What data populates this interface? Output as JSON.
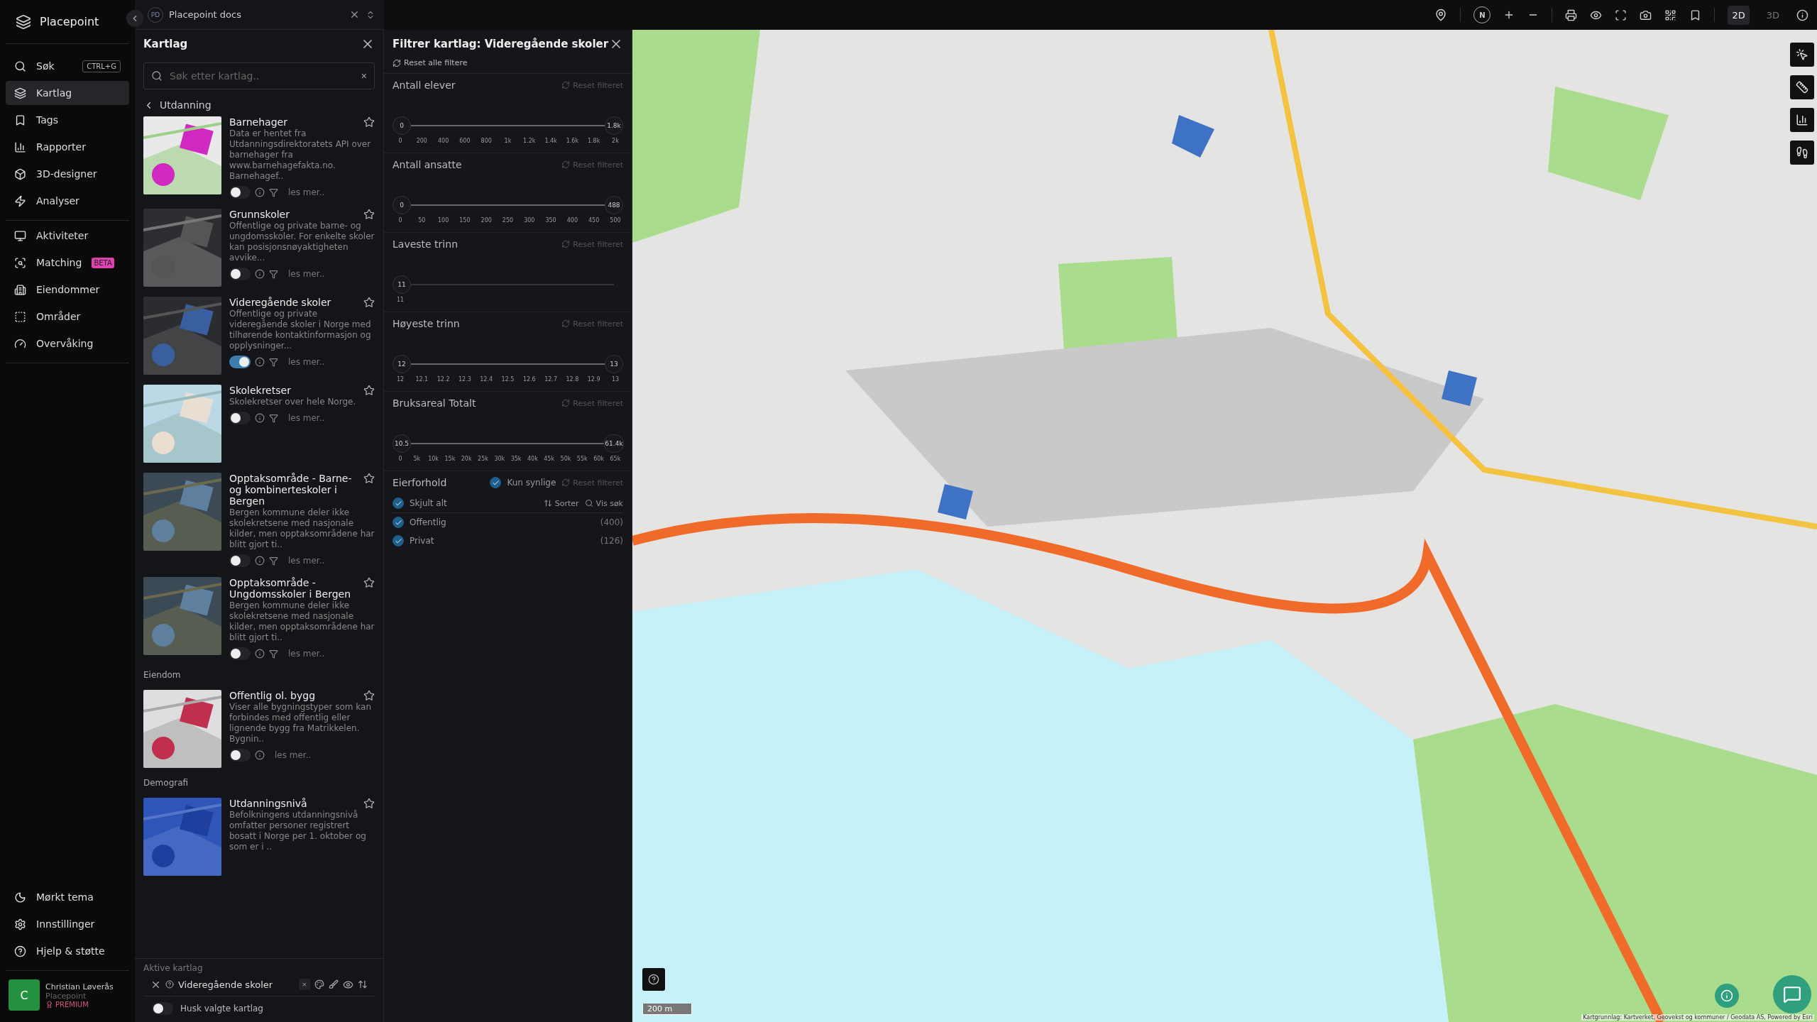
{
  "app": {
    "name": "Placepoint"
  },
  "workspace": {
    "initials": "PD",
    "name": "Placepoint docs"
  },
  "nav_groups": [
    {
      "items": [
        {
          "label": "Søk",
          "shortcut": "CTRL+G",
          "selected": false
        },
        {
          "label": "Kartlag",
          "selected": true
        },
        {
          "label": "Tags",
          "selected": false
        },
        {
          "label": "Rapporter",
          "selected": false
        },
        {
          "label": "3D-designer",
          "selected": false
        },
        {
          "label": "Analyser",
          "selected": false
        }
      ]
    },
    {
      "items": [
        {
          "label": "Aktiviteter",
          "selected": false
        },
        {
          "label": "Matching",
          "badge": "BETA",
          "selected": false
        },
        {
          "label": "Eiendommer",
          "selected": false
        },
        {
          "label": "Områder",
          "selected": false
        },
        {
          "label": "Overvåking",
          "selected": false
        }
      ]
    },
    {
      "items": [
        {
          "label": "Mørkt tema",
          "selected": false
        },
        {
          "label": "Innstillinger",
          "selected": false
        },
        {
          "label": "Hjelp & støtte",
          "selected": false
        }
      ]
    }
  ],
  "user": {
    "initial": "C",
    "name": "Christian Løverås",
    "org": "Placepoint",
    "plan": "PREMIUM"
  },
  "layers_panel": {
    "title": "Kartlag",
    "search_placeholder": "Søk etter kartlag..",
    "clear": "×",
    "category": "Utdanning",
    "items": [
      {
        "kind": "layer",
        "title": "Barnehager",
        "description": "Data er hentet fra Utdanningsdirektoratets API over barnehager fra www.barnehagefakta.no. Barnehagef..",
        "on": false,
        "filterable": true,
        "more": "les mer.."
      },
      {
        "kind": "layer",
        "title": "Grunnskoler",
        "description": "Offentlige og private barne- og ungdomsskoler. For enkelte skoler kan posisjonsnøyaktigheten avvike...",
        "on": false,
        "filterable": true,
        "more": "les mer.."
      },
      {
        "kind": "layer",
        "title": "Videregående skoler",
        "description": "Offentlige og private videregående skoler i Norge med tilhørende kontaktinformasjon og opplysninger...",
        "on": true,
        "filterable": true,
        "more": "les mer.."
      },
      {
        "kind": "layer",
        "title": "Skolekretser",
        "description": "Skolekretser over hele Norge.",
        "on": false,
        "filterable": true,
        "more": "les mer.."
      },
      {
        "kind": "layer",
        "title": "Opptaksområde - Barne- og kombinerteskoler i Bergen",
        "description": "Bergen kommune deler ikke skolekretsene med nasjonale kilder, men opptaksområdene har blitt gjort ti..",
        "on": false,
        "filterable": true,
        "more": "les mer.."
      },
      {
        "kind": "layer",
        "title": "Opptaksområde - Ungdomsskoler i Bergen",
        "description": "Bergen kommune deler ikke skolekretsene med nasjonale kilder, men opptaksområdene har blitt gjort ti..",
        "on": false,
        "filterable": true,
        "more": "les mer.."
      },
      {
        "kind": "section",
        "title": "Eiendom"
      },
      {
        "kind": "layer",
        "title": "Offentlig ol. bygg",
        "description": "Viser alle bygningstyper som kan forbindes med offentlig eller lignende bygg fra Matrikkelen. Bygnin..",
        "on": false,
        "filterable": false,
        "more": "les mer.."
      },
      {
        "kind": "section",
        "title": "Demografi"
      },
      {
        "kind": "layer",
        "title": "Utdanningsnivå",
        "description": "Befolkningens utdanningsnivå omfatter personer registrert bosatt i Norge per 1. oktober og som er i .."
      }
    ],
    "active_title": "Aktive kartlag",
    "active": [
      {
        "name": "Videregående skoler",
        "clear": "×"
      }
    ],
    "remember": {
      "label": "Husk valgte kartlag",
      "on": false
    }
  },
  "filter_panel": {
    "title": "Filtrer kartlag: Videregående skoler",
    "reset_all": "Reset alle filtere",
    "sliders": [
      {
        "title": "Antall elever",
        "reset": "Reset filteret",
        "thumbs": [
          {
            "label": "0",
            "level": 0
          },
          {
            "label": "1.8k",
            "level": 1
          }
        ],
        "ticks": [
          "0",
          "200",
          "400",
          "600",
          "800",
          "1k",
          "1.2k",
          "1.4k",
          "1.6k",
          "1.8k",
          "2k"
        ]
      },
      {
        "title": "Antall ansatte",
        "reset": "Reset filteret",
        "thumbs": [
          {
            "label": "0",
            "level": 0
          },
          {
            "label": "488",
            "level": 1
          }
        ],
        "ticks": [
          "0",
          "50",
          "100",
          "150",
          "200",
          "250",
          "300",
          "350",
          "400",
          "450",
          "500"
        ]
      },
      {
        "title": "Laveste trinn",
        "reset": "Reset filteret",
        "thumbs": [
          {
            "label": "11",
            "level": 0
          }
        ],
        "ticks": [
          "11"
        ]
      },
      {
        "title": "Høyeste trinn",
        "reset": "Reset filteret",
        "thumbs": [
          {
            "label": "12",
            "level": 0
          },
          {
            "label": "13",
            "level": 1
          }
        ],
        "ticks": [
          "12",
          "12.1",
          "12.2",
          "12.3",
          "12.4",
          "12.5",
          "12.6",
          "12.7",
          "12.8",
          "12.9",
          "13"
        ]
      },
      {
        "title": "Bruksareal Totalt",
        "reset": "Reset filteret",
        "thumbs": [
          {
            "label": "10.5",
            "level": 0
          },
          {
            "label": "61.4k",
            "level": 1
          }
        ],
        "ticks": [
          "0",
          "5k",
          "10k",
          "15k",
          "20k",
          "25k",
          "30k",
          "35k",
          "40k",
          "45k",
          "50k",
          "55k",
          "60k",
          "65k"
        ]
      }
    ],
    "category": {
      "title": "Eierforhold",
      "visible_only": {
        "label": "Kun synlige",
        "checked": true
      },
      "reset": "Reset filteret",
      "all": {
        "label": "Skjult alt",
        "checked": true
      },
      "sort": "Sorter",
      "search": "Vis søk",
      "options": [
        {
          "label": "Offentlig",
          "count": "(400)",
          "checked": true
        },
        {
          "label": "Privat",
          "count": "(126)",
          "checked": true
        }
      ]
    }
  },
  "map_toolbar": {
    "compass": "N",
    "modes": [
      {
        "label": "2D",
        "selected": true
      },
      {
        "label": "3D",
        "selected": false
      }
    ]
  },
  "map": {
    "kind": "picture",
    "scale": "200 m",
    "attribution": "Kartgrunnlag: Kartverket, Geovekst og kommuner / Geodata AS, Powered by Esri"
  }
}
